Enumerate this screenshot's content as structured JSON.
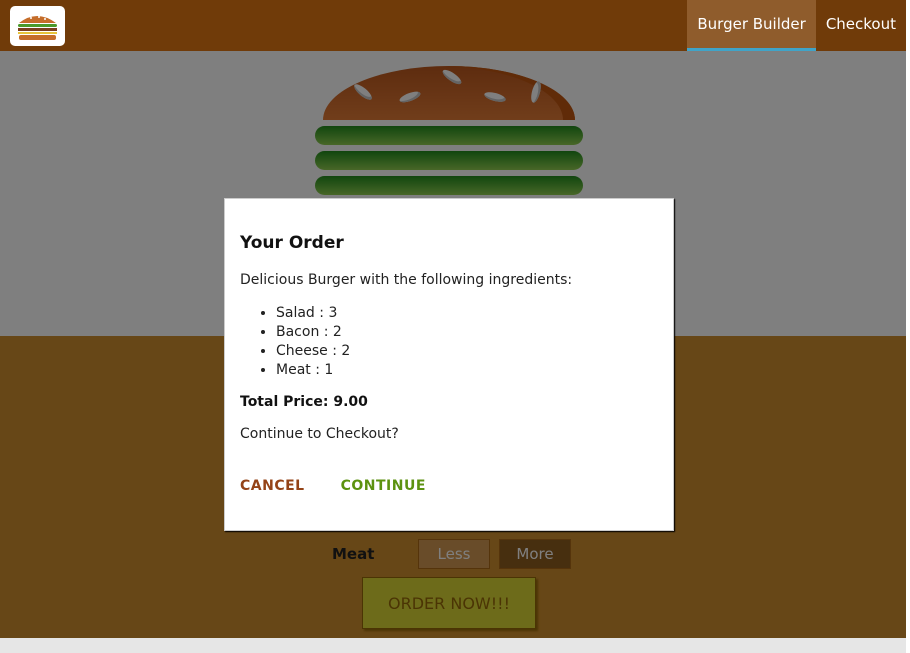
{
  "toolbar": {
    "nav": [
      {
        "label": "Burger Builder",
        "active": true
      },
      {
        "label": "Checkout",
        "active": false
      }
    ]
  },
  "controls": {
    "meat_label": "Meat",
    "less_label": "Less",
    "more_label": "More",
    "order_label": "ORDER NOW!!!"
  },
  "modal": {
    "title": "Your Order",
    "intro": "Delicious Burger with the following ingredients:",
    "ingredients": [
      {
        "text": "Salad : 3"
      },
      {
        "text": "Bacon : 2"
      },
      {
        "text": "Cheese : 2"
      },
      {
        "text": "Meat : 1"
      }
    ],
    "total": "Total Price: 9.00",
    "question": "Continue to Checkout?",
    "cancel_label": "CANCEL",
    "continue_label": "CONTINUE"
  },
  "colors": {
    "toolbar": "#703b09",
    "controls_bg": "#cf8f2e",
    "cancel": "#944317",
    "continue": "#5c9210"
  }
}
